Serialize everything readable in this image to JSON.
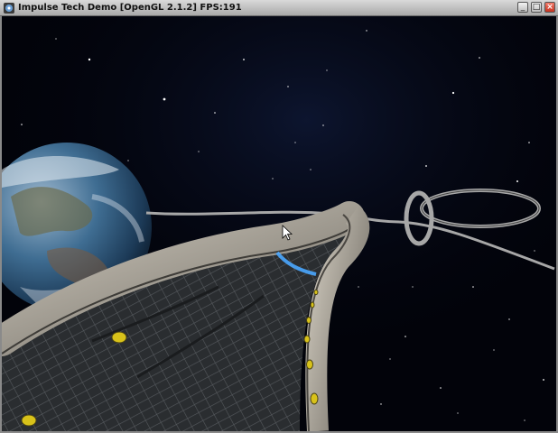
{
  "window": {
    "title": "Impulse Tech Demo [OpenGL 2.1.2] FPS:191",
    "minimize_glyph": "_",
    "maximize_glyph": "□",
    "close_glyph": "×"
  },
  "icons": {
    "app": "app-icon",
    "cursor": "mouse-cursor-icon"
  },
  "colors": {
    "space": "#02030a",
    "track_metal": "#9a968c",
    "track_grate": "#3a3d40",
    "yellow_lights": "#d8c21a",
    "planet_ocean": "#2f5f86"
  }
}
